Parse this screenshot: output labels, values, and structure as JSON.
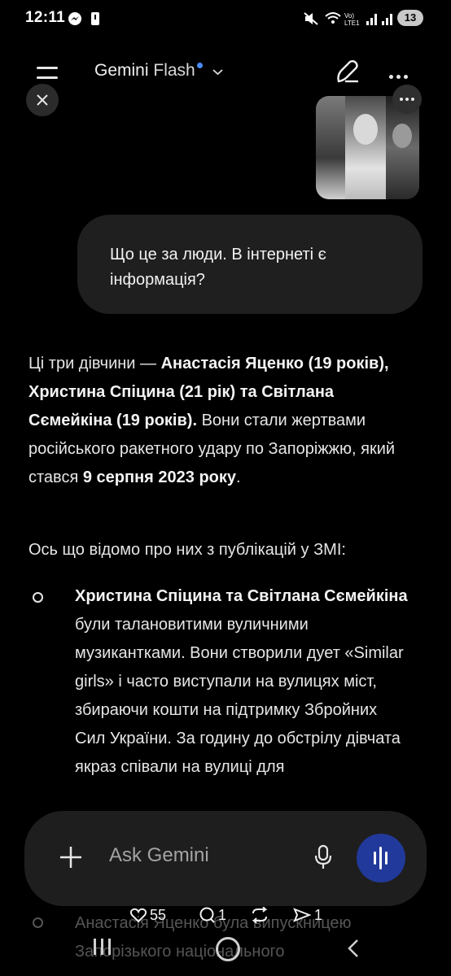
{
  "status_bar": {
    "time": "12:11",
    "battery": "13"
  },
  "header": {
    "title_main": "Gemini",
    "title_model": "Flash"
  },
  "user_message": "Що це за люди. В інтернеті є інформація?",
  "response": {
    "intro_prefix": "Ці три дівчини — ",
    "intro_names": "Анастасія Яценко (19 років), Христина Спіцина (21 рік) та Світлана Сємейкіна (19 років).",
    "intro_mid": " Вони стали жертвами російського ракетного удару по Запоріжжю, який стався ",
    "intro_date": "9 серпня 2023 року",
    "intro_end": ".",
    "sub": "Ось що відомо про них з публікацій у ЗМІ:",
    "bullet1_bold": "Христина Спіцина та Світлана Сємейкіна",
    "bullet1_text": " були талановитими вуличними музикантками. Вони створили дует «Similar girls» і часто виступали на вулицях міст, збираючи кошти на підтримку Збройних Сил України. За годину до обстрілу дівчата якраз співали на вулиці для",
    "bullet2_text": "Анастасія Яценко була випускницею Запорізького національного"
  },
  "input": {
    "placeholder": "Ask Gemini"
  },
  "social": {
    "likes": "55",
    "comments": "1",
    "reposts": "",
    "shares": "1"
  },
  "icons": [
    "menu-icon",
    "chevron-down-icon",
    "edit-icon",
    "more-icon",
    "close-icon",
    "plus-icon",
    "mic-icon",
    "voice-wave-icon",
    "heart-icon",
    "comment-icon",
    "repost-icon",
    "share-icon"
  ]
}
